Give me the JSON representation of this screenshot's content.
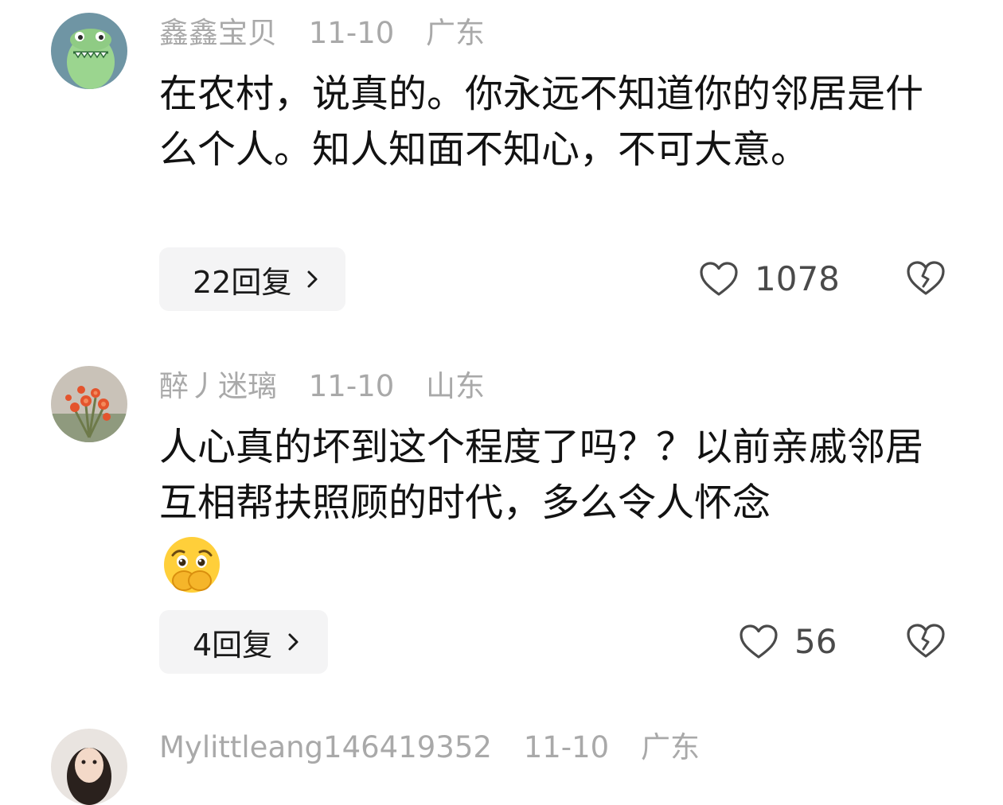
{
  "comments": [
    {
      "username": "鑫鑫宝贝",
      "date": "11-10",
      "location": "广东",
      "text": "在农村，说真的。你永远不知道你的邻居是什么个人。知人知面不知心，不可大意。",
      "replies_label": "22回复",
      "likes": "1078"
    },
    {
      "username": "醉丿迷璃",
      "date": "11-10",
      "location": "山东",
      "text": "人心真的坏到这个程度了吗？？以前亲戚邻居互相帮扶照顾的时代，多么令人怀念",
      "replies_label": "4回复",
      "likes": "56"
    },
    {
      "username": "Mylittleang146419352",
      "date": "11-10",
      "location": "广东"
    }
  ],
  "colors": {
    "meta_text": "#a9a9a9",
    "reply_bg": "#f4f4f5",
    "icon_stroke": "#4a4a4a"
  },
  "icons": {
    "like": "heart-outline-icon",
    "dislike": "broken-heart-icon",
    "reply_chevron": "chevron-right-icon",
    "emoji": "crying-face-emoji"
  }
}
